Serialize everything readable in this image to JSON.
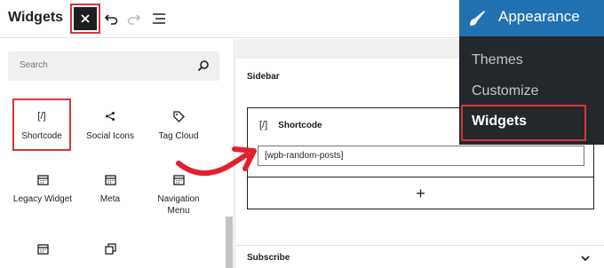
{
  "header": {
    "title": "Widgets"
  },
  "search": {
    "placeholder": "Search"
  },
  "blocks": [
    {
      "label": "Shortcode",
      "icon": "shortcode-icon"
    },
    {
      "label": "Social Icons",
      "icon": "share-icon"
    },
    {
      "label": "Tag Cloud",
      "icon": "tag-icon"
    },
    {
      "label": "Legacy Widget",
      "icon": "calendar-icon"
    },
    {
      "label": "Meta",
      "icon": "calendar-icon"
    },
    {
      "label": "Navigation Menu",
      "icon": "calendar-icon"
    },
    {
      "label": "",
      "icon": "calendar-icon"
    },
    {
      "label": "",
      "icon": "duplicate-icon"
    }
  ],
  "editor": {
    "area_label": "Sidebar",
    "block_title": "Shortcode",
    "block_icon_glyph": "[/]",
    "shortcode_value": "[wpb-random-posts]",
    "add_label": "+",
    "next_area_label": "Subscribe"
  },
  "menu": {
    "title": "Appearance",
    "items": [
      "Themes",
      "Customize",
      "Widgets"
    ]
  },
  "colors": {
    "accent": "#d63638",
    "menu_bg": "#23282d",
    "menu_head": "#2271b1"
  }
}
